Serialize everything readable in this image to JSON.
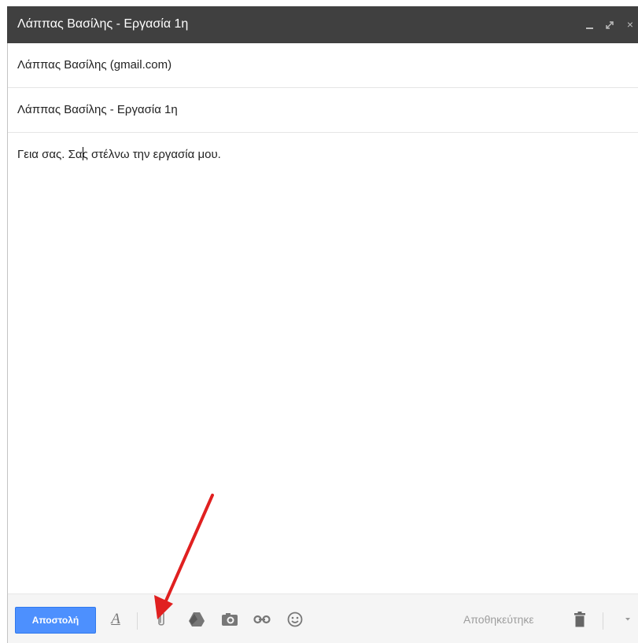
{
  "window": {
    "title": "Λάππας Βασίλης - Εργασία 1η",
    "controls": {
      "minimize_icon": "minimize-icon",
      "popout_icon": "popout-icon",
      "close_label": "×"
    }
  },
  "compose": {
    "to": "Λάππας Βασίλης (gmail.com)",
    "subject": "Λάππας Βασίλης - Εργασία 1η",
    "body_before_cursor": "Γεια σας. Σα",
    "body_after_cursor": "ς στέλνω την εργασία μου."
  },
  "toolbar": {
    "send_label": "Αποστολή",
    "format_label": "A",
    "icons": [
      "attach-icon",
      "drive-icon",
      "photo-icon",
      "link-icon",
      "emoji-icon",
      "trash-icon",
      "chevron-down-icon"
    ],
    "saved_status": "Αποθηκεύτηκε"
  },
  "colors": {
    "titlebar_bg": "#404040",
    "send_button": "#4d90fe",
    "annotation_arrow": "#e02020"
  }
}
